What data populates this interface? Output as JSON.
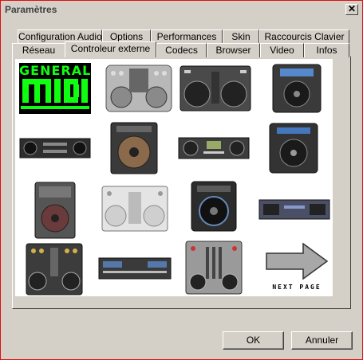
{
  "window": {
    "title": "Paramètres",
    "close_glyph": "✕"
  },
  "tabs": {
    "row1": [
      "Configuration Audio",
      "Options",
      "Performances",
      "Skin",
      "Raccourcis Clavier"
    ],
    "row2": [
      "Réseau",
      "Controleur externe",
      "Codecs",
      "Browser",
      "Video",
      "Infos"
    ],
    "active": "Controleur externe"
  },
  "content": {
    "logo": {
      "line1": "GENERAL",
      "line2": "MIDI",
      "color": "#10ff10"
    },
    "devices": [
      "controller-1",
      "controller-2",
      "controller-3",
      "controller-4",
      "controller-5",
      "controller-6",
      "controller-7",
      "controller-8",
      "controller-9",
      "controller-10",
      "controller-11",
      "controller-12",
      "controller-13",
      "controller-14",
      "controller-15"
    ],
    "next_page_label": "NEXT PAGE"
  },
  "buttons": {
    "ok": "OK",
    "cancel": "Annuler"
  }
}
